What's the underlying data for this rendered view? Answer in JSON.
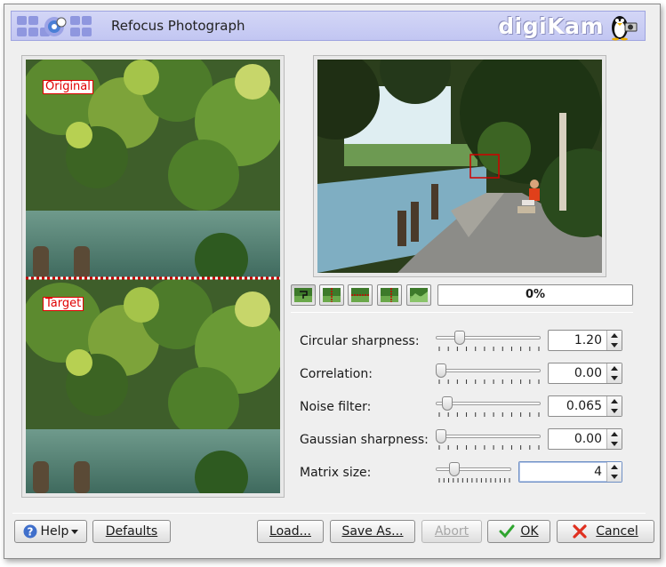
{
  "window": {
    "title": "Refocus Photograph",
    "brand": "digiKam"
  },
  "preview": {
    "original_label": "Original",
    "target_label": "Target"
  },
  "toolbar": {
    "buttons": [
      "original-image-icon",
      "split-vertical-icon",
      "split-horizontal-icon",
      "compare-vertical-icon",
      "compare-horizontal-icon"
    ],
    "progress_value": 0,
    "progress_text": "0%"
  },
  "settings": [
    {
      "label": "Circular sharpness:",
      "value": "1.20",
      "level": 0.2
    },
    {
      "label": "Correlation:",
      "value": "0.00",
      "level": 0.0
    },
    {
      "label": "Noise filter:",
      "value": "0.065",
      "level": 0.065
    },
    {
      "label": "Gaussian sharpness:",
      "value": "0.00",
      "level": 0.0
    },
    {
      "label": "Matrix size:",
      "value": "4",
      "level": 0.2
    }
  ],
  "buttons": {
    "help": "Help",
    "defaults": "Defaults",
    "load": "Load...",
    "save_as": "Save As...",
    "abort": "Abort",
    "ok": "OK",
    "cancel": "Cancel"
  },
  "colors": {
    "header": "#c6c9f3",
    "progress": "#5f87c7",
    "label_red": "#e00000"
  }
}
